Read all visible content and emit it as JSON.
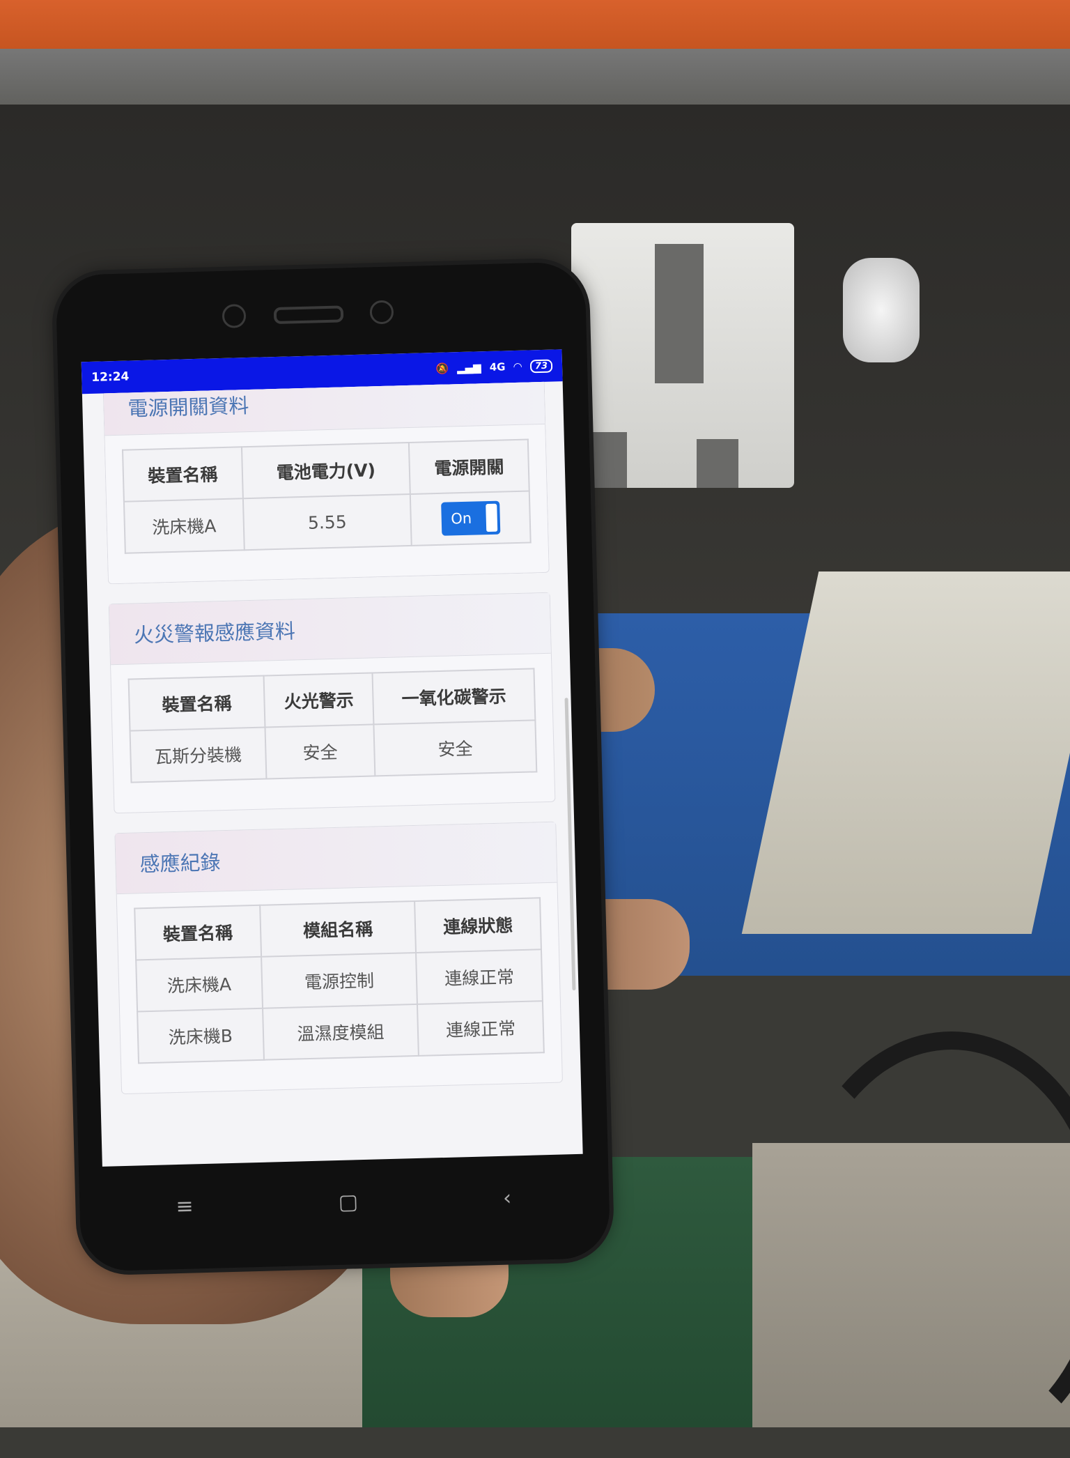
{
  "statusbar": {
    "time": "12:24",
    "network": "4G",
    "battery": "73",
    "icons": [
      "mute-icon",
      "signal-icon",
      "wifi-icon",
      "battery-icon"
    ]
  },
  "colors": {
    "statusbar": "#0a17e6",
    "card_title": "#4c76b4",
    "toggle": "#1a6fe0"
  },
  "power_section": {
    "title": "電源開關資料",
    "headers": [
      "裝置名稱",
      "電池電力(V)",
      "電源開關"
    ],
    "rows": [
      {
        "device": "洗床機A",
        "voltage": "5.55",
        "switch": "On"
      }
    ]
  },
  "fire_section": {
    "title": "火災警報感應資料",
    "headers": [
      "裝置名稱",
      "火光警示",
      "一氧化碳警示"
    ],
    "rows": [
      {
        "device": "瓦斯分裝機",
        "flame": "安全",
        "co": "安全"
      }
    ]
  },
  "log_section": {
    "title": "感應紀錄",
    "headers": [
      "裝置名稱",
      "模組名稱",
      "連線狀態"
    ],
    "rows": [
      {
        "device": "洗床機A",
        "module": "電源控制",
        "status": "連線正常"
      },
      {
        "device": "洗床機B",
        "module": "溫濕度模組",
        "status": "連線正常"
      }
    ]
  },
  "navbar": {
    "menu": "≡",
    "home": "▢",
    "back": "‹"
  }
}
